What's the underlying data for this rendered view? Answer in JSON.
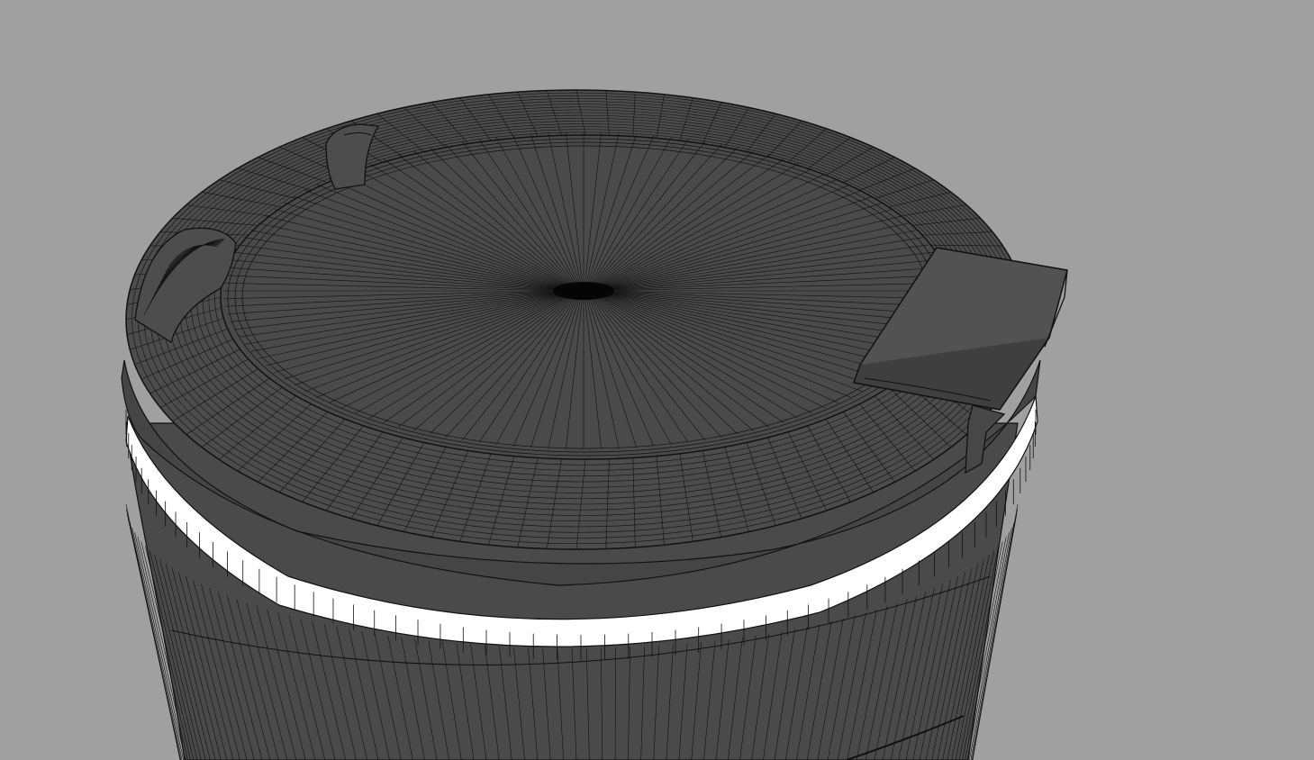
{
  "viewport": {
    "background": "#a0a0a0",
    "shading": "wireframe-on-shaded",
    "object": "cylindrical-container-with-lid"
  },
  "colors": {
    "body": "#4a4a4a",
    "body_dark": "#3e3e3e",
    "wire": "#111111",
    "band": "#ffffff",
    "hinge": "#525252"
  },
  "mesh": {
    "radial_segments": 128,
    "ring_count": 16,
    "body_segments": 96
  }
}
